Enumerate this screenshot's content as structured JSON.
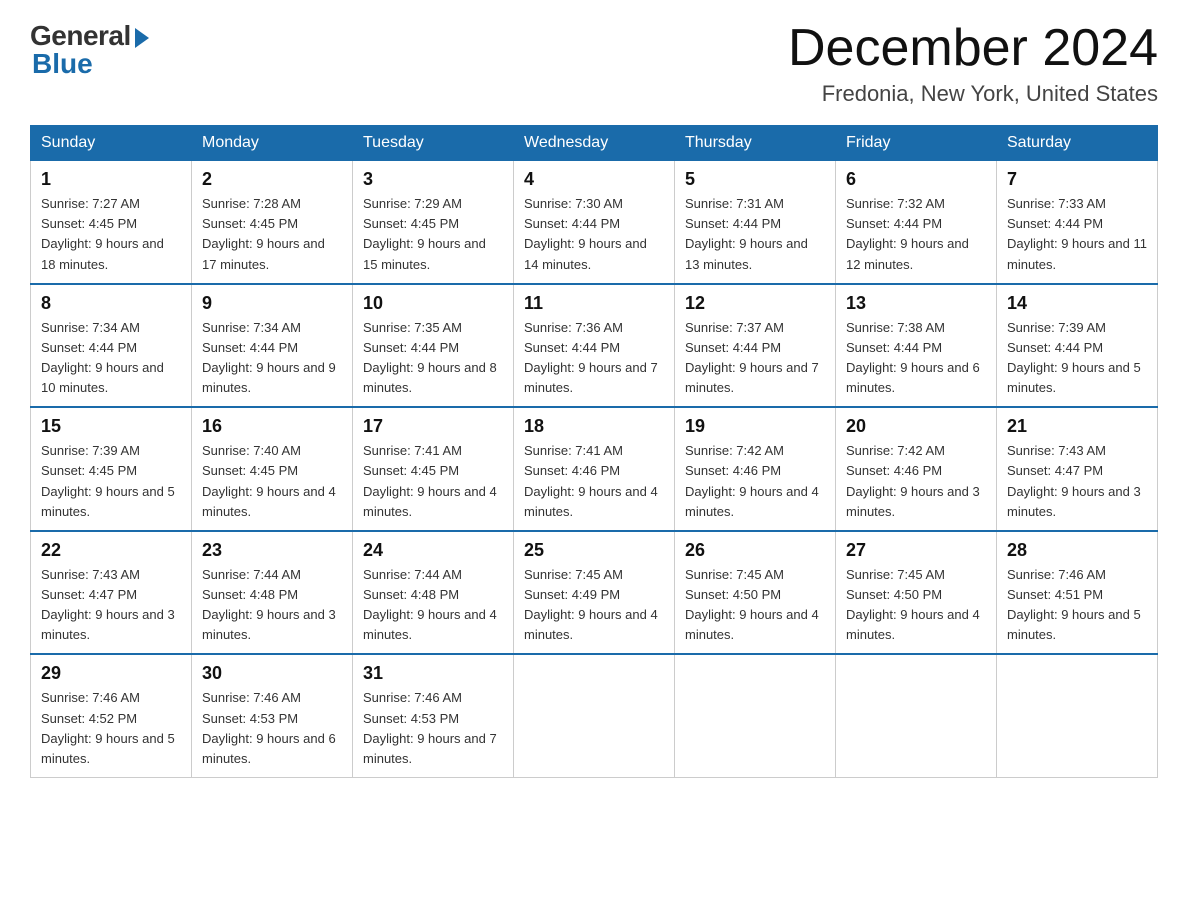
{
  "header": {
    "logo_general": "General",
    "logo_blue": "Blue",
    "month_title": "December 2024",
    "location": "Fredonia, New York, United States"
  },
  "days_of_week": [
    "Sunday",
    "Monday",
    "Tuesday",
    "Wednesday",
    "Thursday",
    "Friday",
    "Saturday"
  ],
  "weeks": [
    [
      {
        "day": 1,
        "sunrise": "7:27 AM",
        "sunset": "4:45 PM",
        "daylight": "9 hours and 18 minutes."
      },
      {
        "day": 2,
        "sunrise": "7:28 AM",
        "sunset": "4:45 PM",
        "daylight": "9 hours and 17 minutes."
      },
      {
        "day": 3,
        "sunrise": "7:29 AM",
        "sunset": "4:45 PM",
        "daylight": "9 hours and 15 minutes."
      },
      {
        "day": 4,
        "sunrise": "7:30 AM",
        "sunset": "4:44 PM",
        "daylight": "9 hours and 14 minutes."
      },
      {
        "day": 5,
        "sunrise": "7:31 AM",
        "sunset": "4:44 PM",
        "daylight": "9 hours and 13 minutes."
      },
      {
        "day": 6,
        "sunrise": "7:32 AM",
        "sunset": "4:44 PM",
        "daylight": "9 hours and 12 minutes."
      },
      {
        "day": 7,
        "sunrise": "7:33 AM",
        "sunset": "4:44 PM",
        "daylight": "9 hours and 11 minutes."
      }
    ],
    [
      {
        "day": 8,
        "sunrise": "7:34 AM",
        "sunset": "4:44 PM",
        "daylight": "9 hours and 10 minutes."
      },
      {
        "day": 9,
        "sunrise": "7:34 AM",
        "sunset": "4:44 PM",
        "daylight": "9 hours and 9 minutes."
      },
      {
        "day": 10,
        "sunrise": "7:35 AM",
        "sunset": "4:44 PM",
        "daylight": "9 hours and 8 minutes."
      },
      {
        "day": 11,
        "sunrise": "7:36 AM",
        "sunset": "4:44 PM",
        "daylight": "9 hours and 7 minutes."
      },
      {
        "day": 12,
        "sunrise": "7:37 AM",
        "sunset": "4:44 PM",
        "daylight": "9 hours and 7 minutes."
      },
      {
        "day": 13,
        "sunrise": "7:38 AM",
        "sunset": "4:44 PM",
        "daylight": "9 hours and 6 minutes."
      },
      {
        "day": 14,
        "sunrise": "7:39 AM",
        "sunset": "4:44 PM",
        "daylight": "9 hours and 5 minutes."
      }
    ],
    [
      {
        "day": 15,
        "sunrise": "7:39 AM",
        "sunset": "4:45 PM",
        "daylight": "9 hours and 5 minutes."
      },
      {
        "day": 16,
        "sunrise": "7:40 AM",
        "sunset": "4:45 PM",
        "daylight": "9 hours and 4 minutes."
      },
      {
        "day": 17,
        "sunrise": "7:41 AM",
        "sunset": "4:45 PM",
        "daylight": "9 hours and 4 minutes."
      },
      {
        "day": 18,
        "sunrise": "7:41 AM",
        "sunset": "4:46 PM",
        "daylight": "9 hours and 4 minutes."
      },
      {
        "day": 19,
        "sunrise": "7:42 AM",
        "sunset": "4:46 PM",
        "daylight": "9 hours and 4 minutes."
      },
      {
        "day": 20,
        "sunrise": "7:42 AM",
        "sunset": "4:46 PM",
        "daylight": "9 hours and 3 minutes."
      },
      {
        "day": 21,
        "sunrise": "7:43 AM",
        "sunset": "4:47 PM",
        "daylight": "9 hours and 3 minutes."
      }
    ],
    [
      {
        "day": 22,
        "sunrise": "7:43 AM",
        "sunset": "4:47 PM",
        "daylight": "9 hours and 3 minutes."
      },
      {
        "day": 23,
        "sunrise": "7:44 AM",
        "sunset": "4:48 PM",
        "daylight": "9 hours and 3 minutes."
      },
      {
        "day": 24,
        "sunrise": "7:44 AM",
        "sunset": "4:48 PM",
        "daylight": "9 hours and 4 minutes."
      },
      {
        "day": 25,
        "sunrise": "7:45 AM",
        "sunset": "4:49 PM",
        "daylight": "9 hours and 4 minutes."
      },
      {
        "day": 26,
        "sunrise": "7:45 AM",
        "sunset": "4:50 PM",
        "daylight": "9 hours and 4 minutes."
      },
      {
        "day": 27,
        "sunrise": "7:45 AM",
        "sunset": "4:50 PM",
        "daylight": "9 hours and 4 minutes."
      },
      {
        "day": 28,
        "sunrise": "7:46 AM",
        "sunset": "4:51 PM",
        "daylight": "9 hours and 5 minutes."
      }
    ],
    [
      {
        "day": 29,
        "sunrise": "7:46 AM",
        "sunset": "4:52 PM",
        "daylight": "9 hours and 5 minutes."
      },
      {
        "day": 30,
        "sunrise": "7:46 AM",
        "sunset": "4:53 PM",
        "daylight": "9 hours and 6 minutes."
      },
      {
        "day": 31,
        "sunrise": "7:46 AM",
        "sunset": "4:53 PM",
        "daylight": "9 hours and 7 minutes."
      },
      null,
      null,
      null,
      null
    ]
  ]
}
